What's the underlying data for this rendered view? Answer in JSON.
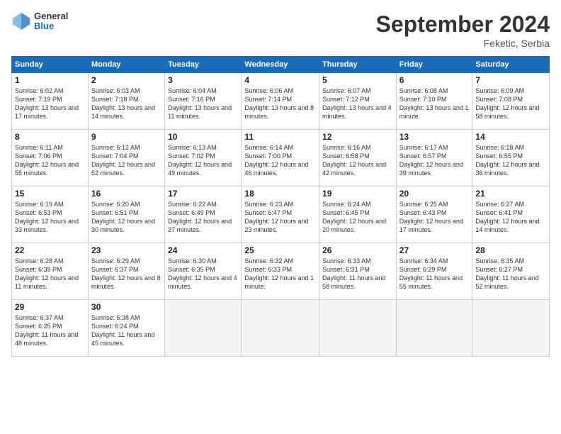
{
  "header": {
    "logo_general": "General",
    "logo_blue": "Blue",
    "month_title": "September 2024",
    "location": "Feketic, Serbia"
  },
  "days_of_week": [
    "Sunday",
    "Monday",
    "Tuesday",
    "Wednesday",
    "Thursday",
    "Friday",
    "Saturday"
  ],
  "weeks": [
    [
      {
        "day": "1",
        "info": "Sunrise: 6:02 AM\nSunset: 7:19 PM\nDaylight: 13 hours and 17 minutes."
      },
      {
        "day": "2",
        "info": "Sunrise: 6:03 AM\nSunset: 7:18 PM\nDaylight: 13 hours and 14 minutes."
      },
      {
        "day": "3",
        "info": "Sunrise: 6:04 AM\nSunset: 7:16 PM\nDaylight: 13 hours and 11 minutes."
      },
      {
        "day": "4",
        "info": "Sunrise: 6:06 AM\nSunset: 7:14 PM\nDaylight: 13 hours and 8 minutes."
      },
      {
        "day": "5",
        "info": "Sunrise: 6:07 AM\nSunset: 7:12 PM\nDaylight: 13 hours and 4 minutes."
      },
      {
        "day": "6",
        "info": "Sunrise: 6:08 AM\nSunset: 7:10 PM\nDaylight: 13 hours and 1 minute."
      },
      {
        "day": "7",
        "info": "Sunrise: 6:09 AM\nSunset: 7:08 PM\nDaylight: 12 hours and 58 minutes."
      }
    ],
    [
      {
        "day": "8",
        "info": "Sunrise: 6:11 AM\nSunset: 7:06 PM\nDaylight: 12 hours and 55 minutes."
      },
      {
        "day": "9",
        "info": "Sunrise: 6:12 AM\nSunset: 7:04 PM\nDaylight: 12 hours and 52 minutes."
      },
      {
        "day": "10",
        "info": "Sunrise: 6:13 AM\nSunset: 7:02 PM\nDaylight: 12 hours and 49 minutes."
      },
      {
        "day": "11",
        "info": "Sunrise: 6:14 AM\nSunset: 7:00 PM\nDaylight: 12 hours and 46 minutes."
      },
      {
        "day": "12",
        "info": "Sunrise: 6:16 AM\nSunset: 6:58 PM\nDaylight: 12 hours and 42 minutes."
      },
      {
        "day": "13",
        "info": "Sunrise: 6:17 AM\nSunset: 6:57 PM\nDaylight: 12 hours and 39 minutes."
      },
      {
        "day": "14",
        "info": "Sunrise: 6:18 AM\nSunset: 6:55 PM\nDaylight: 12 hours and 36 minutes."
      }
    ],
    [
      {
        "day": "15",
        "info": "Sunrise: 6:19 AM\nSunset: 6:53 PM\nDaylight: 12 hours and 33 minutes."
      },
      {
        "day": "16",
        "info": "Sunrise: 6:20 AM\nSunset: 6:51 PM\nDaylight: 12 hours and 30 minutes."
      },
      {
        "day": "17",
        "info": "Sunrise: 6:22 AM\nSunset: 6:49 PM\nDaylight: 12 hours and 27 minutes."
      },
      {
        "day": "18",
        "info": "Sunrise: 6:23 AM\nSunset: 6:47 PM\nDaylight: 12 hours and 23 minutes."
      },
      {
        "day": "19",
        "info": "Sunrise: 6:24 AM\nSunset: 6:45 PM\nDaylight: 12 hours and 20 minutes."
      },
      {
        "day": "20",
        "info": "Sunrise: 6:25 AM\nSunset: 6:43 PM\nDaylight: 12 hours and 17 minutes."
      },
      {
        "day": "21",
        "info": "Sunrise: 6:27 AM\nSunset: 6:41 PM\nDaylight: 12 hours and 14 minutes."
      }
    ],
    [
      {
        "day": "22",
        "info": "Sunrise: 6:28 AM\nSunset: 6:39 PM\nDaylight: 12 hours and 11 minutes."
      },
      {
        "day": "23",
        "info": "Sunrise: 6:29 AM\nSunset: 6:37 PM\nDaylight: 12 hours and 8 minutes."
      },
      {
        "day": "24",
        "info": "Sunrise: 6:30 AM\nSunset: 6:35 PM\nDaylight: 12 hours and 4 minutes."
      },
      {
        "day": "25",
        "info": "Sunrise: 6:32 AM\nSunset: 6:33 PM\nDaylight: 12 hours and 1 minute."
      },
      {
        "day": "26",
        "info": "Sunrise: 6:33 AM\nSunset: 6:31 PM\nDaylight: 11 hours and 58 minutes."
      },
      {
        "day": "27",
        "info": "Sunrise: 6:34 AM\nSunset: 6:29 PM\nDaylight: 11 hours and 55 minutes."
      },
      {
        "day": "28",
        "info": "Sunrise: 6:35 AM\nSunset: 6:27 PM\nDaylight: 11 hours and 52 minutes."
      }
    ],
    [
      {
        "day": "29",
        "info": "Sunrise: 6:37 AM\nSunset: 6:25 PM\nDaylight: 11 hours and 48 minutes."
      },
      {
        "day": "30",
        "info": "Sunrise: 6:38 AM\nSunset: 6:24 PM\nDaylight: 11 hours and 45 minutes."
      },
      {
        "day": "",
        "info": ""
      },
      {
        "day": "",
        "info": ""
      },
      {
        "day": "",
        "info": ""
      },
      {
        "day": "",
        "info": ""
      },
      {
        "day": "",
        "info": ""
      }
    ]
  ]
}
